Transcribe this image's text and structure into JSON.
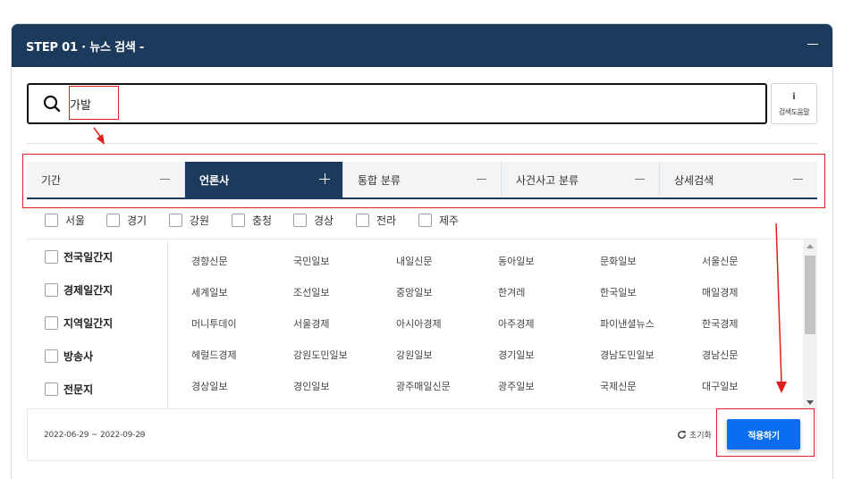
{
  "header": {
    "title": "STEP 01 · 뉴스 검색 -"
  },
  "search": {
    "value": "가발",
    "placeholder": ""
  },
  "help": {
    "icon": "info-icon",
    "icon_glyph": "i",
    "label": "검색도움말"
  },
  "tabs": [
    {
      "label": "기간",
      "active": false
    },
    {
      "label": "언론사",
      "active": true
    },
    {
      "label": "통합 분류",
      "active": false
    },
    {
      "label": "사건사고 분류",
      "active": false
    },
    {
      "label": "상세검색",
      "active": false
    }
  ],
  "regions": [
    "서울",
    "경기",
    "강원",
    "충청",
    "경상",
    "전라",
    "제주"
  ],
  "categories": [
    "전국일간지",
    "경제일간지",
    "지역일간지",
    "방송사",
    "전문지"
  ],
  "outlets": [
    [
      "경향신문",
      "국민일보",
      "내일신문",
      "동아일보",
      "문화일보",
      "서울신문"
    ],
    [
      "세계일보",
      "조선일보",
      "중앙일보",
      "한겨레",
      "한국일보",
      "매일경제"
    ],
    [
      "머니투데이",
      "서울경제",
      "아시아경제",
      "아주경제",
      "파이낸셜뉴스",
      "한국경제"
    ],
    [
      "헤럴드경제",
      "강원도민일보",
      "강원일보",
      "경기일보",
      "경남도민일보",
      "경남신문"
    ],
    [
      "경상일보",
      "경인일보",
      "광주매일신문",
      "광주일보",
      "국제신문",
      "대구일보"
    ]
  ],
  "footer": {
    "date_range": "2022-06-29 ~ 2022-09-29",
    "date_clear": "×",
    "reset_label": "초기화",
    "apply_label": "적용하기"
  },
  "colors": {
    "header": "#1c3a5c",
    "apply": "#0b6ef0",
    "annotation": "#e0201c"
  }
}
